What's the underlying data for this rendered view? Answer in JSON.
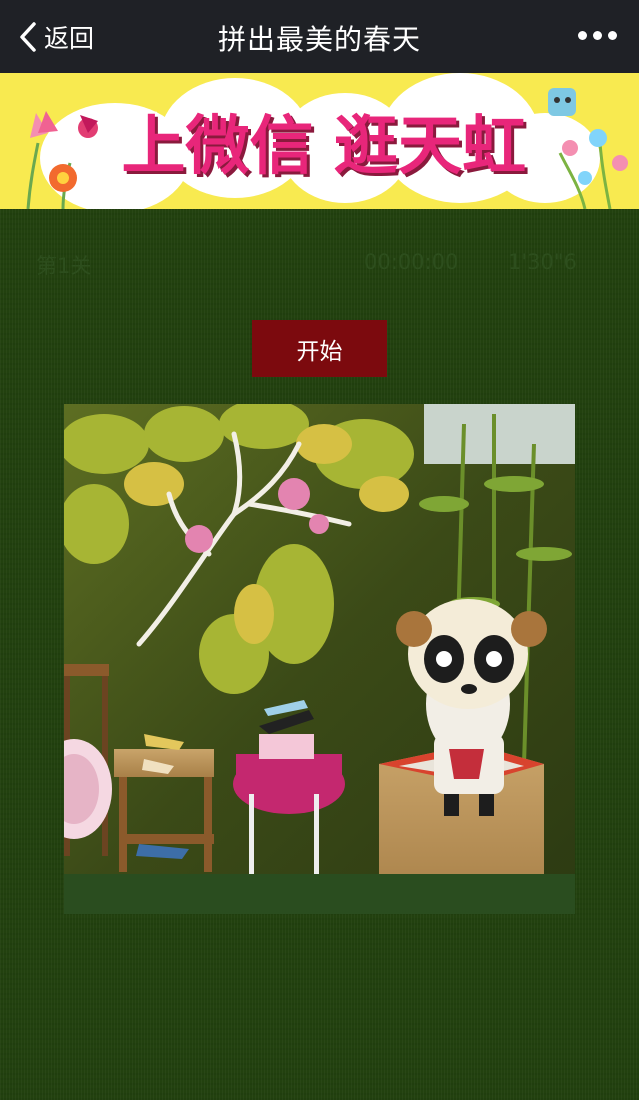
{
  "nav": {
    "back_label": "返回",
    "title": "拼出最美的春天"
  },
  "banner": {
    "text_left": "上微信",
    "text_right": "逛天虹"
  },
  "game": {
    "level": "第1关",
    "timer": "00:00:00",
    "best": "1'30\"6",
    "start_label": "开始"
  },
  "colors": {
    "nav_bg": "#1f2126",
    "banner_bg": "#f8ea50",
    "banner_text": "#e8267a",
    "page_bg": "#22410f",
    "start_button": "#7c0a0e"
  },
  "icons": {
    "back": "chevron-left-icon",
    "more": "more-dots-icon"
  }
}
